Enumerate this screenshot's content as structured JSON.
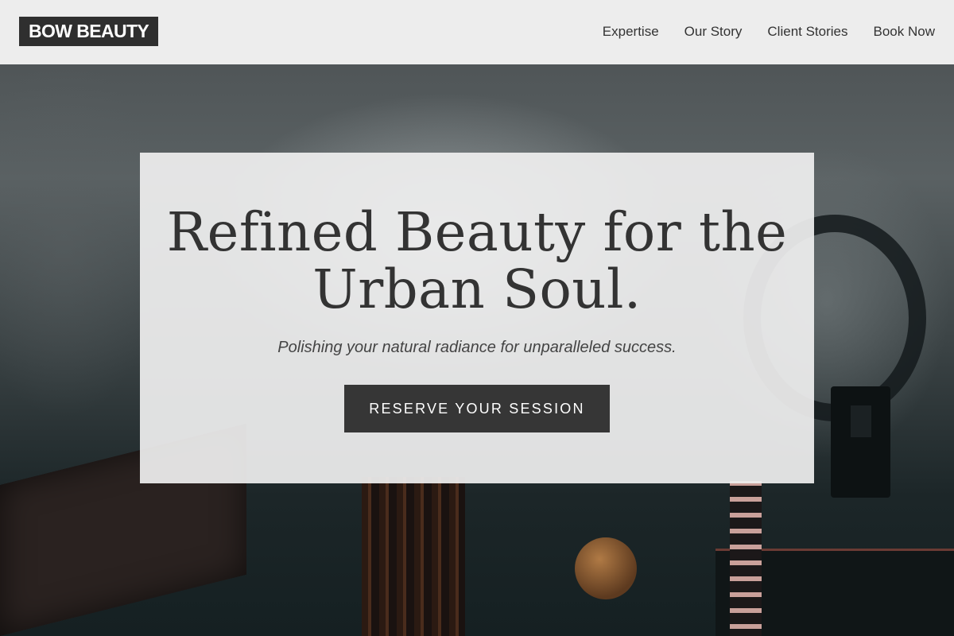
{
  "brand": {
    "logo_text": "BOW BEAUTY"
  },
  "nav": {
    "items": [
      {
        "label": "Expertise"
      },
      {
        "label": "Our Story"
      },
      {
        "label": "Client Stories"
      },
      {
        "label": "Book Now"
      }
    ]
  },
  "hero": {
    "title_line1": "Refined Beauty for the",
    "title_line2": "Urban Soul.",
    "subtitle": "Polishing your natural radiance for unparalleled success.",
    "cta_label": "RESERVE YOUR SESSION"
  },
  "colors": {
    "header_bg": "#f4f4f4",
    "logo_bg": "#2f2f2f",
    "cta_bg": "#363636",
    "text": "#333333"
  }
}
